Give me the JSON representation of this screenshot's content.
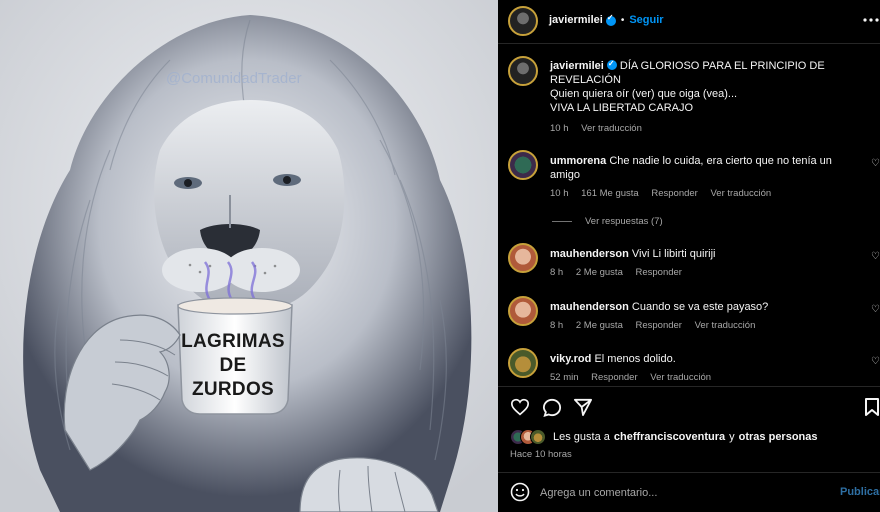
{
  "post_image": {
    "watermark": "@ComunidadTrader",
    "mug_text_line1": "LAGRIMAS",
    "mug_text_line2": "DE ZURDOS"
  },
  "header": {
    "username": "javiermilei",
    "dot": "•",
    "follow_label": "Seguir",
    "more_icon": "more-horizontal-icon"
  },
  "caption": {
    "username": "javiermilei",
    "line1": "DÍA GLORIOSO PARA EL PRINCIPIO DE",
    "line2": "REVELACIÓN",
    "line3": "Quien quiera oír (ver) que oiga (vea)...",
    "line4": "VIVA LA LIBERTAD CARAJO",
    "time": "10 h",
    "translate": "Ver traducción"
  },
  "comments": [
    {
      "username": "ummorena",
      "text1": "Che nadie lo cuida, era cierto que no tenía un",
      "text2": "amigo",
      "time": "10 h",
      "likes": "161 Me gusta",
      "reply": "Responder",
      "translate": "Ver traducción",
      "replies": "Ver respuestas (7)"
    },
    {
      "username": "mauhenderson",
      "text1": "Vivi Li libirti quiriji",
      "time": "8 h",
      "likes": "2 Me gusta",
      "reply": "Responder"
    },
    {
      "username": "mauhenderson",
      "text1": "Cuando se va este payaso?",
      "time": "8 h",
      "likes": "2 Me gusta",
      "reply": "Responder",
      "translate": "Ver traducción"
    },
    {
      "username": "viky.rod",
      "text1": "El menos dolido.",
      "time": "52 min",
      "reply": "Responder",
      "translate": "Ver traducción"
    }
  ],
  "actions": {
    "likes_prefix": "Les gusta a",
    "likes_user": "cheffranciscoventura",
    "likes_mid": "y",
    "likes_others": "otras personas",
    "time_ago": "Hace 10 horas"
  },
  "comment_box": {
    "placeholder": "Agrega un comentario...",
    "publish": "Publicar"
  }
}
